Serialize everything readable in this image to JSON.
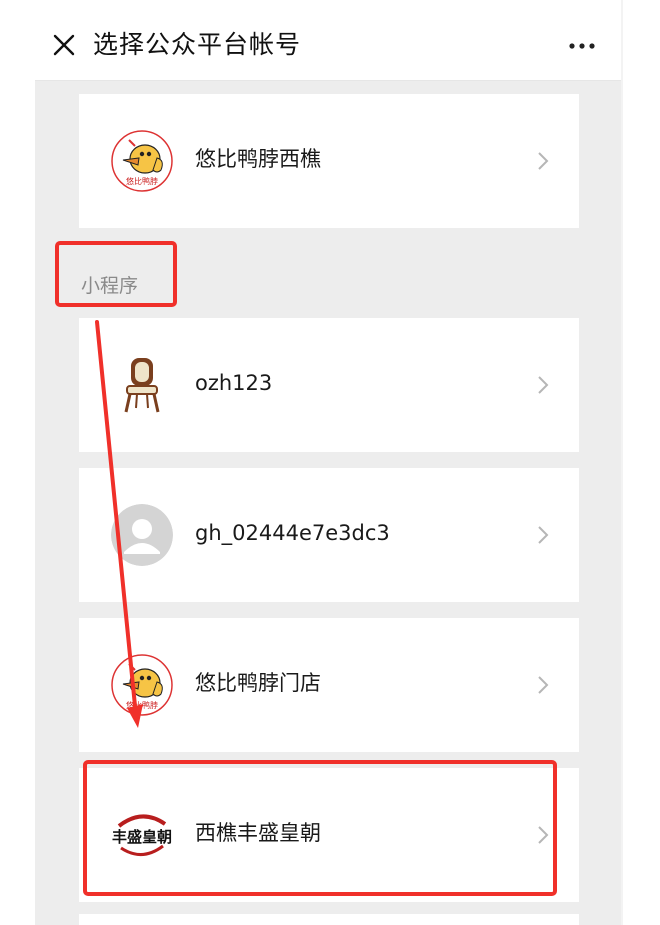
{
  "header": {
    "title": "选择公众平台帐号",
    "close_icon": "close-icon",
    "more_icon": "more-icon"
  },
  "section": {
    "label": "小程序"
  },
  "accounts": [
    {
      "name": "悠比鸭脖西樵",
      "avatar": "duck-logo-avatar",
      "logo_text": "悠比鸭脖"
    },
    {
      "name": "ozh123",
      "avatar": "chair-avatar"
    },
    {
      "name": "gh_02444e7e3dc3",
      "avatar": "default-person-avatar"
    },
    {
      "name": "悠比鸭脖门店",
      "avatar": "duck-logo-avatar",
      "logo_text": "悠比鸭脖"
    },
    {
      "name": "西樵丰盛皇朝",
      "avatar": "calligraphy-logo-avatar",
      "logo_text": "丰盛皇朝"
    }
  ],
  "colors": {
    "highlight": "#f0302a",
    "background": "#ededed",
    "card": "#ffffff"
  }
}
